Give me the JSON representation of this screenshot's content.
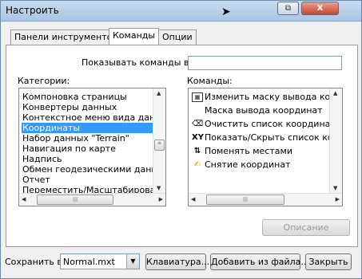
{
  "window": {
    "title": "Настроить",
    "buttons": {
      "restore": "⧉",
      "close": "X"
    }
  },
  "tabs": [
    {
      "label": "Панели инструментов",
      "active": false
    },
    {
      "label": "Команды",
      "active": true
    },
    {
      "label": "Опции",
      "active": false
    }
  ],
  "show_commands": {
    "label": "Показывать команды в:",
    "value": ""
  },
  "categories": {
    "label": "Категории:",
    "items": [
      "Компоновка страницы",
      "Конвертеры данных",
      "Контекстное меню вида данных",
      "Координаты",
      "Набор данных \"Terrain\"",
      "Навигация по карте",
      "Надпись",
      "Обмен геодезическими данными",
      "Отчет",
      "Переместить/Масштабировать"
    ],
    "selected": "Координаты"
  },
  "commands": {
    "label": "Команды:",
    "items": [
      {
        "label": "Изменить маску вывода координ",
        "icon": "mask-edit-icon"
      },
      {
        "label": "Маска вывода координат",
        "icon": ""
      },
      {
        "label": "Очистить список координат",
        "icon": "eraser-icon"
      },
      {
        "label": "Показать/Скрыть список коорди",
        "icon": "coordinate-list-icon"
      },
      {
        "label": "Поменять местами",
        "icon": "swap-icon"
      },
      {
        "label": "Снятие координат",
        "icon": "capture-coordinates-icon"
      }
    ]
  },
  "description_button": "Описание",
  "footer": {
    "save_label": "Сохранить в:",
    "save_value": "Normal.mxt",
    "keyboard_button": "Клавиатура...",
    "add_from_file_button": "Добавить из файла...",
    "close_button": "Закрыть"
  }
}
